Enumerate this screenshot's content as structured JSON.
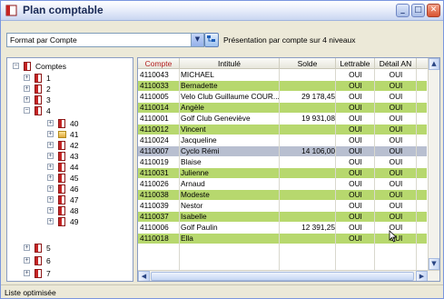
{
  "window": {
    "title": "Plan comptable"
  },
  "toolbar": {
    "format_select": "Format par Compte",
    "presentation_label": "Présentation par compte sur 4 niveaux"
  },
  "tree": {
    "root": "Comptes",
    "nodes": [
      "1",
      "2",
      "3",
      "4",
      "40",
      "41",
      "42",
      "43",
      "44",
      "45",
      "46",
      "47",
      "48",
      "49",
      "5",
      "6",
      "7"
    ]
  },
  "grid": {
    "columns": [
      "Compte",
      "Intitulé",
      "Solde",
      "Lettrable",
      "Détail AN"
    ],
    "rows": [
      {
        "compte": "4110043",
        "intitule": "MICHAEL",
        "solde": "",
        "lettrable": "OUI",
        "detail": "OUI"
      },
      {
        "compte": "4110033",
        "intitule": "Bernadette",
        "solde": "",
        "lettrable": "OUI",
        "detail": "OUI"
      },
      {
        "compte": "4110005",
        "intitule": "Velo Club Guillaume COUR...",
        "solde": "29 178,45",
        "lettrable": "OUI",
        "detail": "OUI"
      },
      {
        "compte": "4110014",
        "intitule": "Angèle",
        "solde": "",
        "lettrable": "OUI",
        "detail": "OUI"
      },
      {
        "compte": "4110001",
        "intitule": "Golf Club Geneviève",
        "solde": "19 931,08",
        "lettrable": "OUI",
        "detail": "OUI"
      },
      {
        "compte": "4110012",
        "intitule": "Vincent",
        "solde": "",
        "lettrable": "OUI",
        "detail": "OUI"
      },
      {
        "compte": "4110024",
        "intitule": "Jacqueline",
        "solde": "",
        "lettrable": "OUI",
        "detail": "OUI"
      },
      {
        "compte": "4110007",
        "intitule": "Cyclo Rémi",
        "solde": "14 106,00",
        "lettrable": "OUI",
        "detail": "OUI"
      },
      {
        "compte": "4110019",
        "intitule": "Blaise",
        "solde": "",
        "lettrable": "OUI",
        "detail": "OUI"
      },
      {
        "compte": "4110031",
        "intitule": "Julienne",
        "solde": "",
        "lettrable": "OUI",
        "detail": "OUI"
      },
      {
        "compte": "4110026",
        "intitule": "Arnaud",
        "solde": "",
        "lettrable": "OUI",
        "detail": "OUI"
      },
      {
        "compte": "4110038",
        "intitule": "Modeste",
        "solde": "",
        "lettrable": "OUI",
        "detail": "OUI"
      },
      {
        "compte": "4110039",
        "intitule": "Nestor",
        "solde": "",
        "lettrable": "OUI",
        "detail": "OUI"
      },
      {
        "compte": "4110037",
        "intitule": "Isabelle",
        "solde": "",
        "lettrable": "OUI",
        "detail": "OUI"
      },
      {
        "compte": "4110006",
        "intitule": "Golf Paulin",
        "solde": "12 391,25",
        "lettrable": "OUI",
        "detail": "OUI"
      },
      {
        "compte": "4110018",
        "intitule": "Ella",
        "solde": "",
        "lettrable": "OUI",
        "detail": "OUI"
      }
    ]
  },
  "status": {
    "text": "Liste optimisée"
  }
}
